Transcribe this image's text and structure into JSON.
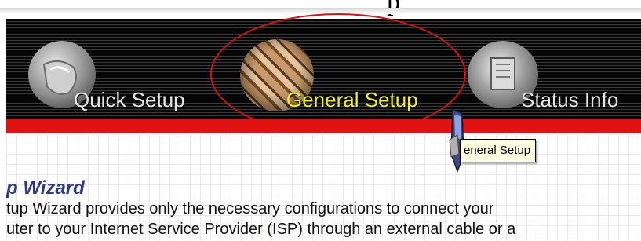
{
  "page_scrap": "p",
  "nav": {
    "items": [
      {
        "label": "Quick Setup",
        "icon": "quick-setup-icon",
        "active": false
      },
      {
        "label": "General Setup",
        "icon": "general-setup-icon",
        "active": true
      },
      {
        "label": "Status Info",
        "icon": "status-info-icon",
        "active": false
      }
    ],
    "colors": {
      "active_label": "#f3ef1b",
      "label": "#e6e6e6",
      "highlight_ring": "#d81010",
      "bar": "#e01212"
    }
  },
  "tooltip": {
    "text": "eneral Setup"
  },
  "wizard": {
    "title": "p Wizard",
    "lines": [
      "tup Wizard provides only the necessary configurations to connect your",
      "uter to your Internet Service Provider (ISP) through an external cable or a"
    ]
  }
}
